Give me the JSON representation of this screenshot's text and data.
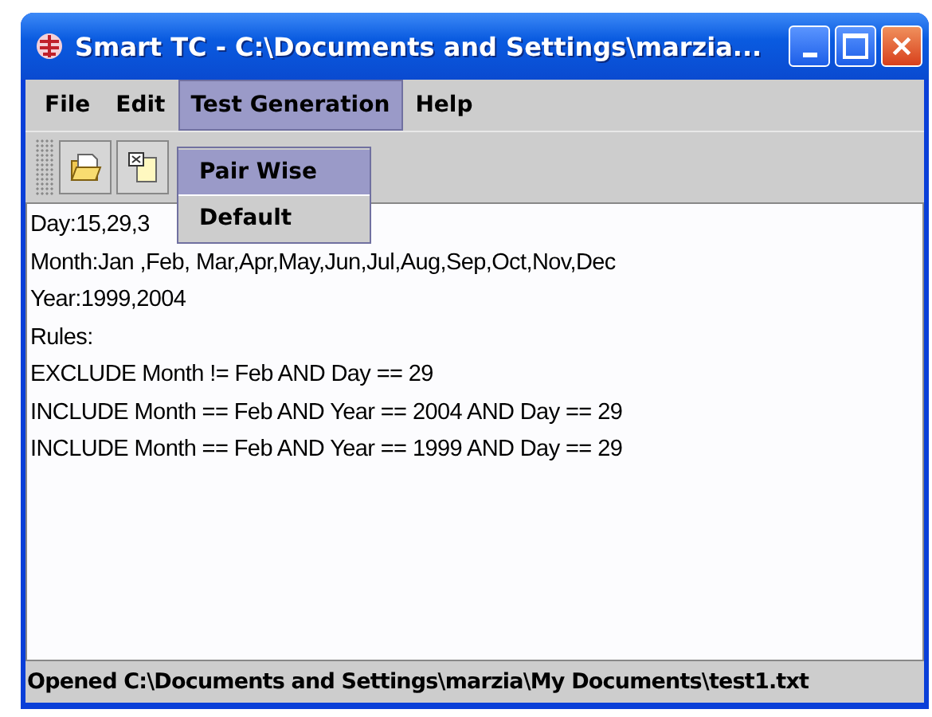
{
  "window": {
    "title": "Smart TC - C:\\Documents and Settings\\marzia..."
  },
  "menu_bar": [
    {
      "label": "File",
      "selected": false
    },
    {
      "label": "Edit",
      "selected": false
    },
    {
      "label": "Test Generation",
      "selected": true
    },
    {
      "label": "Help",
      "selected": false
    }
  ],
  "dropdown": [
    {
      "label": "Pair Wise",
      "selected": true
    },
    {
      "label": "Default",
      "selected": false
    }
  ],
  "editor": {
    "lines": [
      "Day:15,29,3",
      "Month:Jan ,Feb, Mar,Apr,May,Jun,Jul,Aug,Sep,Oct,Nov,Dec",
      "Year:1999,2004",
      "Rules:",
      "EXCLUDE Month != Feb AND Day == 29",
      "INCLUDE Month == Feb AND Year == 2004 AND Day == 29",
      "INCLUDE Month == Feb AND Year == 1999 AND Day == 29"
    ]
  },
  "status_bar": "Opened C:\\Documents and Settings\\marzia\\My Documents\\test1.txt"
}
